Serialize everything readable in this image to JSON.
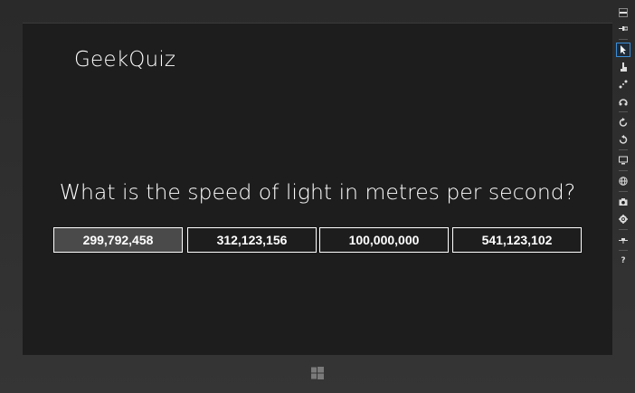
{
  "app": {
    "title": "GeekQuiz"
  },
  "quiz": {
    "question": "What is the speed of light in metres per second?",
    "answers": [
      "299,792,458",
      "312,123,156",
      "100,000,000",
      "541,123,102"
    ],
    "hovered_answer_index": 0
  },
  "simulator_toolbar": {
    "items": [
      {
        "icon": "minimize-icon"
      },
      {
        "icon": "pin-icon"
      },
      {
        "icon": "mouse-mode-icon",
        "selected": true
      },
      {
        "icon": "touch-mode-icon"
      },
      {
        "icon": "pinch-zoom-icon"
      },
      {
        "icon": "rotation-touch-icon"
      },
      {
        "icon": "rotate-clockwise-icon"
      },
      {
        "icon": "rotate-counterclockwise-icon"
      },
      {
        "icon": "change-resolution-icon"
      },
      {
        "icon": "set-location-icon"
      },
      {
        "icon": "screenshot-icon"
      },
      {
        "icon": "screenshot-settings-icon"
      },
      {
        "icon": "network-icon"
      },
      {
        "icon": "help-icon",
        "label": "?"
      }
    ]
  },
  "colors": {
    "background": "#1d1d1d",
    "text": "#ffffff",
    "hover": "#4a4a4a",
    "selection": "#3a8ed8"
  }
}
